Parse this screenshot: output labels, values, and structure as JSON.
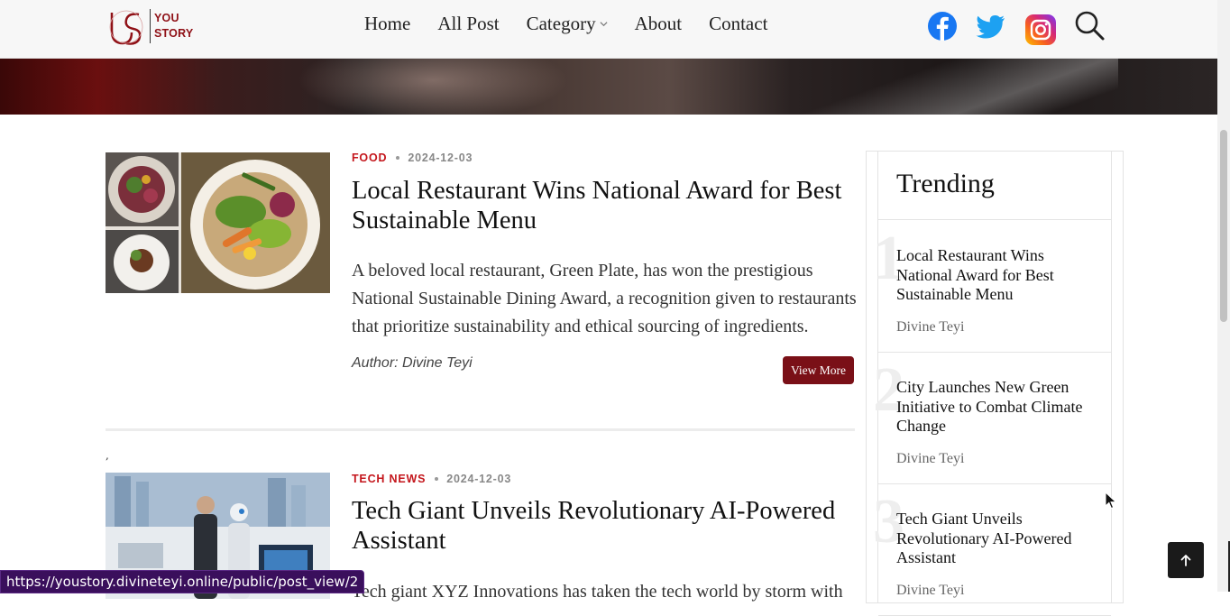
{
  "header": {
    "logo": {
      "line1": "YOU",
      "line2": "STORY"
    },
    "nav": [
      {
        "label": "Home"
      },
      {
        "label": "All Post"
      },
      {
        "label": "Category"
      },
      {
        "label": "About"
      },
      {
        "label": "Contact"
      }
    ],
    "social": [
      "facebook-icon",
      "twitter-icon",
      "instagram-icon",
      "search-icon"
    ]
  },
  "articles": [
    {
      "category": "FOOD",
      "date": "2024-12-03",
      "title": "Local Restaurant Wins National Award for Best Sustainable Menu",
      "excerpt": "A beloved local restaurant, Green Plate, has won the prestigious National Sustainable Dining Award, a recognition given to restaurants that prioritize sustainability and ethical sourcing of ingredients.",
      "author": "Author: Divine Teyi",
      "button": "View More"
    },
    {
      "category": "TECH NEWS",
      "date": "2024-12-03",
      "title": "Tech Giant Unveils Revolutionary AI-Powered Assistant",
      "excerpt": "Tech giant XYZ Innovations has taken the tech world by storm with"
    }
  ],
  "separator_tick": ",",
  "sidebar": {
    "title": "Trending",
    "items": [
      {
        "num": "1",
        "title": "Local Restaurant Wins National Award for Best Sustainable Menu",
        "author": "Divine Teyi"
      },
      {
        "num": "2",
        "title": "City Launches New Green Initiative to Combat Climate Change",
        "author": "Divine Teyi"
      },
      {
        "num": "3",
        "title": "Tech Giant Unveils Revolutionary AI-Powered Assistant",
        "author": "Divine Teyi"
      }
    ]
  },
  "status_url": "https://youstory.divineteyi.online/public/post_view/2",
  "colors": {
    "accent": "#c4161c",
    "button": "#7a1017",
    "facebook": "#1877f2",
    "twitter": "#1da1f2"
  }
}
